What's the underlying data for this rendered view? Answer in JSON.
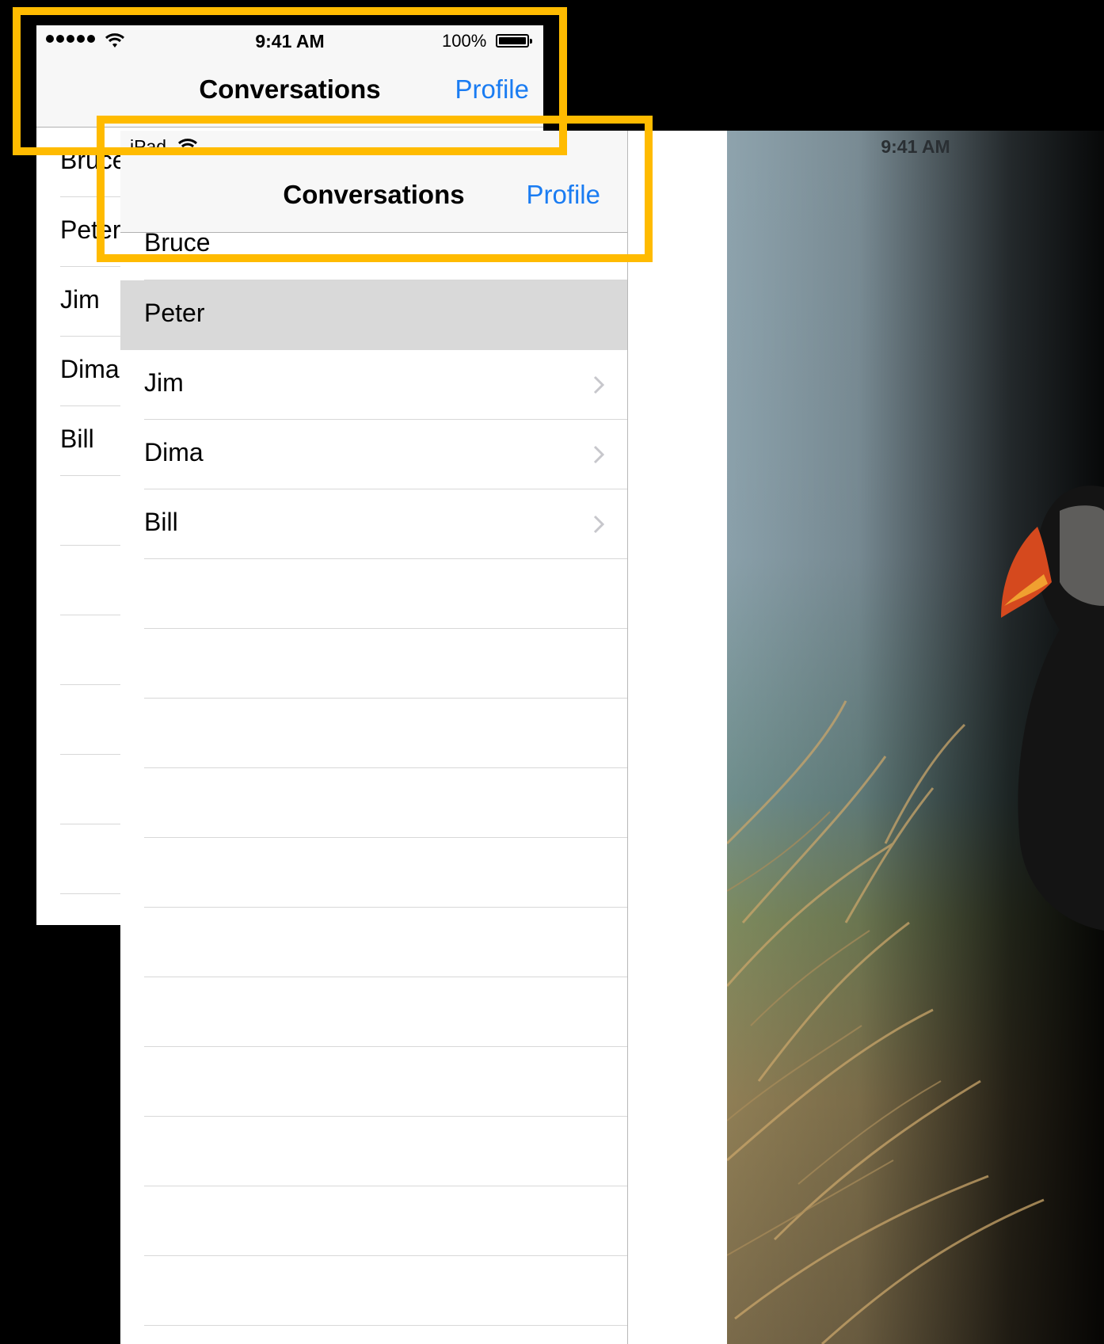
{
  "iphone": {
    "status_bar": {
      "time": "9:41 AM",
      "battery_percent": "100%"
    },
    "nav_bar": {
      "title": "Conversations",
      "right_button": "Profile"
    },
    "rows": [
      "Bruce",
      "Peter",
      "Jim",
      "Dima",
      "Bill"
    ]
  },
  "ipad": {
    "status_bar": {
      "device": "iPad",
      "time": "9:41 AM"
    },
    "master": {
      "nav_bar": {
        "title": "Conversations",
        "right_button": "Profile"
      },
      "rows": [
        {
          "label": "Bruce",
          "selected": false
        },
        {
          "label": "Peter",
          "selected": true
        },
        {
          "label": "Jim",
          "selected": false
        },
        {
          "label": "Dima",
          "selected": false
        },
        {
          "label": "Bill",
          "selected": false
        }
      ]
    }
  },
  "colors": {
    "highlight": "#ffbb00",
    "tint": "#1a7cf2",
    "selected_row": "#d9d9d9",
    "background": "#000000"
  }
}
